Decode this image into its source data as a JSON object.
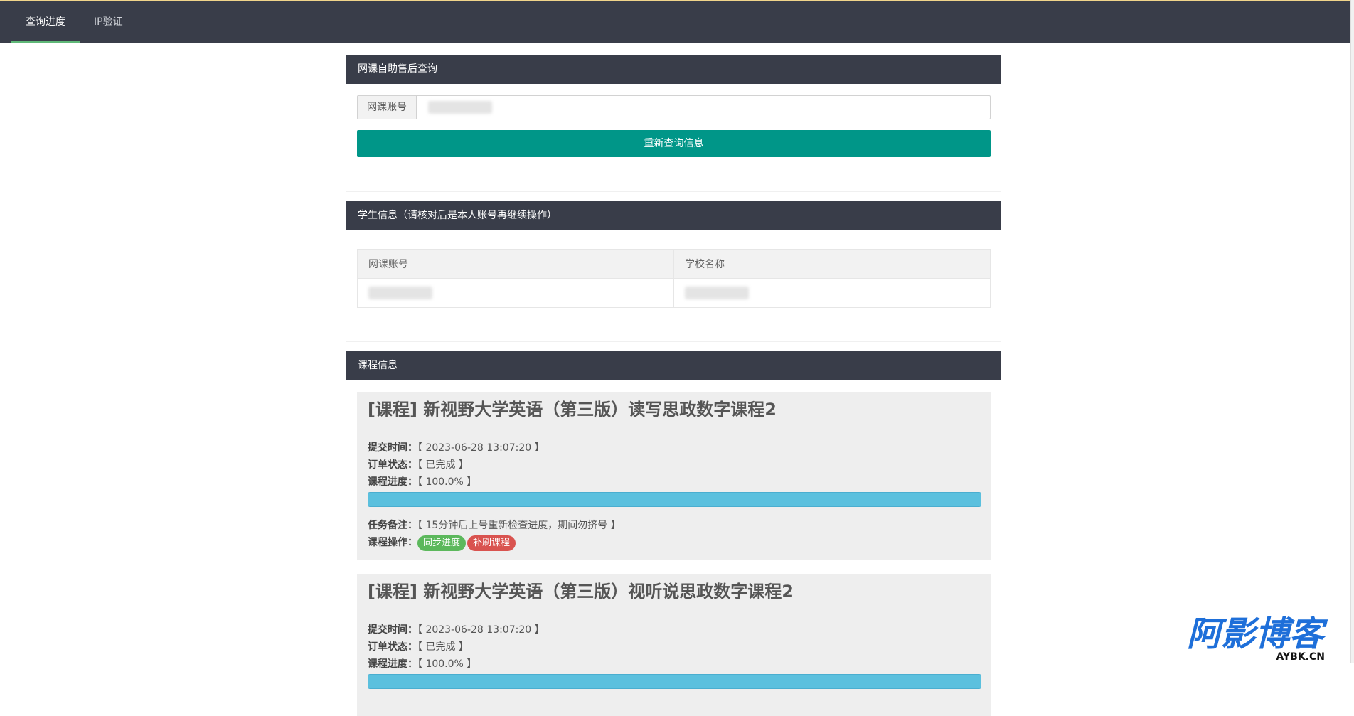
{
  "nav": {
    "tabs": [
      {
        "label": "查询进度",
        "active": true
      },
      {
        "label": "IP验证",
        "active": false
      }
    ]
  },
  "query_panel": {
    "title": "网课自助售后查询",
    "account_label": "网课账号",
    "account_value": "",
    "button_label": "重新查询信息"
  },
  "student_panel": {
    "title": "学生信息（请核对后是本人账号再继续操作）",
    "headers": [
      "网课账号",
      "学校名称"
    ],
    "row": [
      "",
      ""
    ]
  },
  "course_panel": {
    "title": "课程信息",
    "courses": [
      {
        "title": "[课程] 新视野大学英语（第三版）读写思政数字课程2",
        "submit_label": "提交时间：",
        "submit_time": "【 2023-06-28 13:07:20 】",
        "status_label": "订单状态：",
        "status": "【 已完成 】",
        "progress_label": "课程进度：",
        "progress_text": "【 100.0% 】",
        "progress_value": 100,
        "note_label": "任务备注：",
        "note": "【 15分钟后上号重新检查进度，期间勿挤号 】",
        "ops_label": "课程操作：",
        "ops": [
          "同步进度",
          "补刷课程"
        ]
      },
      {
        "title": "[课程] 新视野大学英语（第三版）视听说思政数字课程2",
        "submit_label": "提交时间：",
        "submit_time": "【 2023-06-28 13:07:20 】",
        "status_label": "订单状态：",
        "status": "【 已完成 】",
        "progress_label": "课程进度：",
        "progress_text": "【 100.0% 】",
        "progress_value": 100
      }
    ]
  },
  "watermark": {
    "text": "阿影博客",
    "sub": "AYBK.CN"
  },
  "colors": {
    "header": "#393d49",
    "primary": "#009688",
    "progress": "#5bc0de",
    "green": "#5cb85c",
    "red": "#d9534f",
    "tab_indicator": "#5fb878"
  }
}
